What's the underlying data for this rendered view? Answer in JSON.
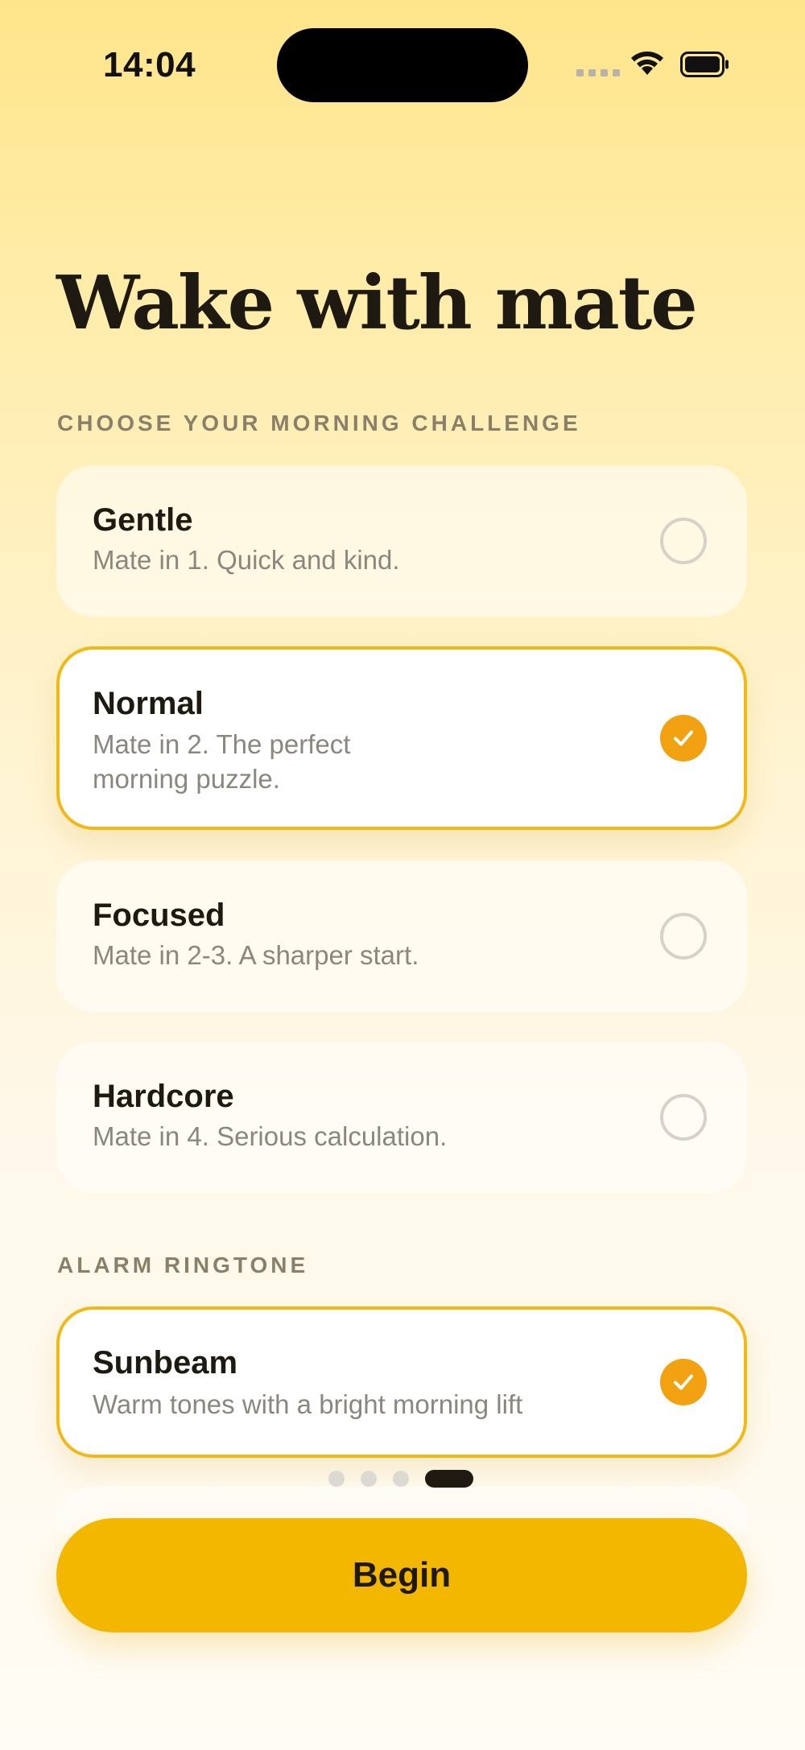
{
  "status_bar": {
    "time": "14:04"
  },
  "title": "Wake with mate",
  "challenge_section": {
    "label": "CHOOSE YOUR MORNING CHALLENGE",
    "options": [
      {
        "title": "Gentle",
        "description": "Mate in 1. Quick and kind.",
        "selected": false
      },
      {
        "title": "Normal",
        "description": "Mate in 2. The perfect morning puzzle.",
        "selected": true
      },
      {
        "title": "Focused",
        "description": "Mate in 2-3. A sharper start.",
        "selected": false
      },
      {
        "title": "Hardcore",
        "description": "Mate in 4. Serious calculation.",
        "selected": false
      }
    ]
  },
  "ringtone_section": {
    "label": "ALARM RINGTONE",
    "options": [
      {
        "title": "Sunbeam",
        "description": "Warm tones with a bright morning lift",
        "selected": true
      }
    ]
  },
  "pager": {
    "total": 4,
    "current": 4
  },
  "begin_button": {
    "label": "Begin"
  },
  "colors": {
    "accent": "#F4B700",
    "check": "#F2A111",
    "selected_border": "#F1B916",
    "text": "#1E1A12",
    "muted": "#8B877F"
  },
  "icons": {
    "check": "checkmark-icon",
    "wifi": "wifi-icon",
    "battery": "battery-icon",
    "signal": "cellular-signal-icon"
  }
}
